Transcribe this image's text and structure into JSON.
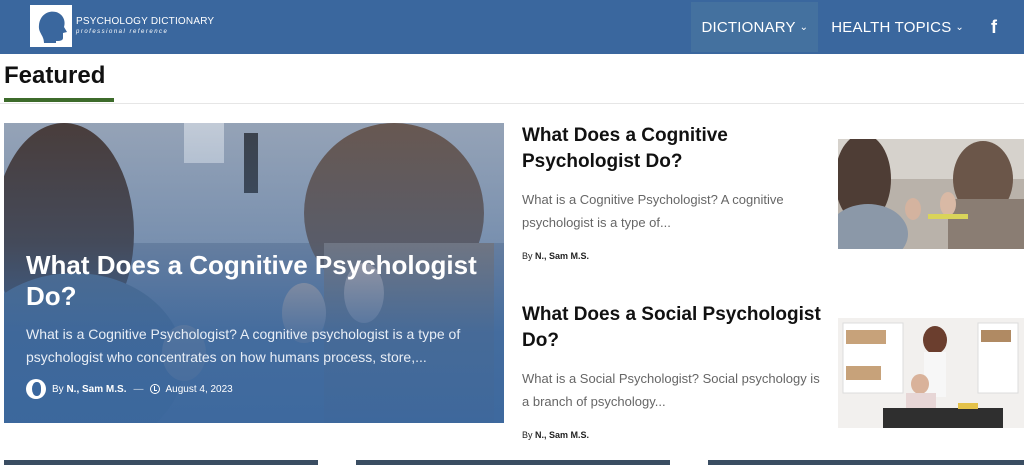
{
  "site": {
    "logo_title": "PSYCHOLOGY DICTIONARY",
    "logo_subtitle": "professional reference",
    "nav": [
      {
        "label": "DICTIONARY"
      },
      {
        "label": "HEALTH TOPICS"
      }
    ],
    "social_icon": "facebook-icon"
  },
  "featured": {
    "heading": "Featured",
    "hero": {
      "title": "What Does a Cognitive Psychologist Do?",
      "excerpt": "What is a Cognitive Psychologist? A cognitive psychologist is a type of psychologist who concentrates on how humans process, store,...",
      "by": "By",
      "author": "N., Sam M.S.",
      "separator": "—",
      "date": "August 4, 2023"
    },
    "cards": [
      {
        "title": "What Does a Cognitive Psychologist Do?",
        "excerpt": "What is a Cognitive Psychologist? A cognitive psychologist is a type of...",
        "by": "By",
        "author": "N., Sam M.S."
      },
      {
        "title": "What Does a Social Psychologist Do?",
        "excerpt": "What is a Social Psychologist? Social psychology is a branch of psychology...",
        "by": "By",
        "author": "N., Sam M.S."
      }
    ]
  },
  "colors": {
    "header": "#3a679e",
    "accent_underline": "#3d6b2b"
  }
}
